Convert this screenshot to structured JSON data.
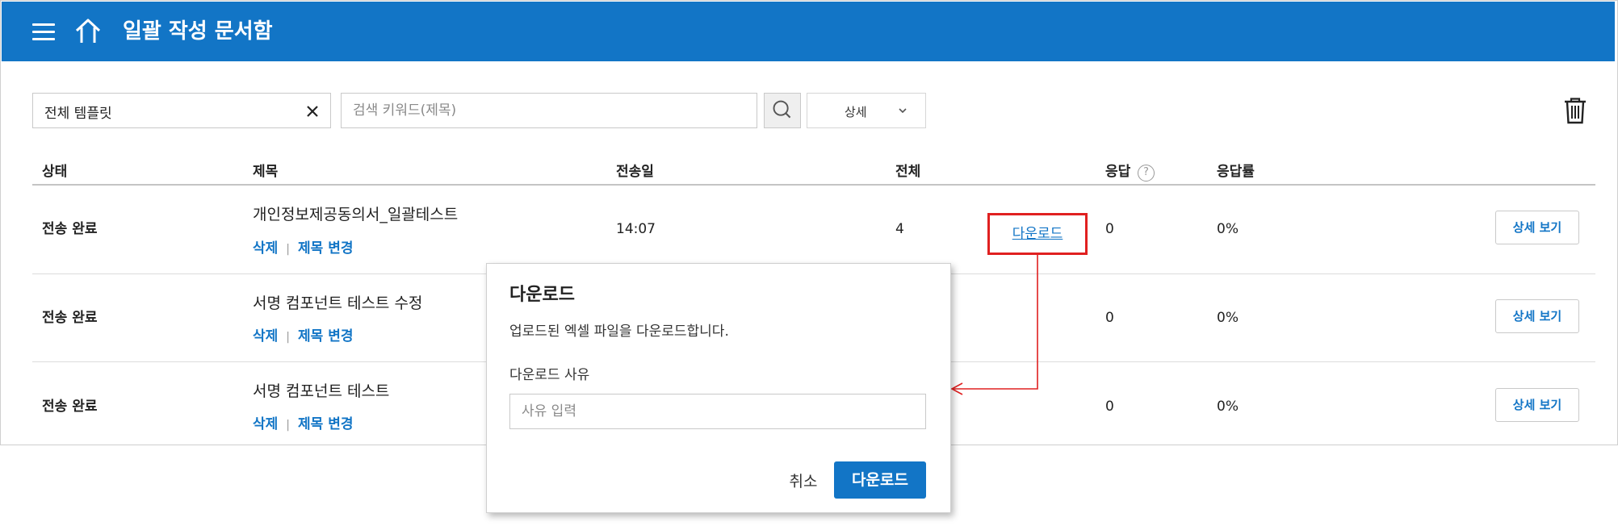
{
  "header": {
    "title": "일괄 작성 문서함",
    "menu_icon": "hamburger-menu-icon",
    "home_icon": "home-icon"
  },
  "toolbar": {
    "template_filter": "전체 템플릿",
    "search_placeholder": "검색 키워드(제목)",
    "detail_label": "상세"
  },
  "table": {
    "headers": {
      "status": "상태",
      "title": "제목",
      "sent": "전송일",
      "total": "전체",
      "response": "응답",
      "rate": "응답률"
    },
    "rows": [
      {
        "status": "전송 완료",
        "title": "개인정보제공동의서_일괄테스트",
        "delete": "삭제",
        "rename": "제목 변경",
        "sent": "14:07",
        "total": "4",
        "response": "0",
        "rate": "0%",
        "detail": "상세 보기",
        "download": "다운로드"
      },
      {
        "status": "전송 완료",
        "title": "서명 컴포넌트 테스트 수정",
        "delete": "삭제",
        "rename": "제목 변경",
        "response": "0",
        "rate": "0%",
        "detail": "상세 보기"
      },
      {
        "status": "전송 완료",
        "title": "서명 컴포넌트 테스트",
        "delete": "삭제",
        "rename": "제목 변경",
        "response": "0",
        "rate": "0%",
        "detail": "상세 보기"
      }
    ]
  },
  "dialog": {
    "title": "다운로드",
    "description": "업로드된 엑셀 파일을 다운로드합니다.",
    "reason_label": "다운로드 사유",
    "reason_placeholder": "사유 입력",
    "cancel": "취소",
    "confirm": "다운로드"
  },
  "colors": {
    "primary": "#1275c6",
    "highlight": "#e02020"
  }
}
